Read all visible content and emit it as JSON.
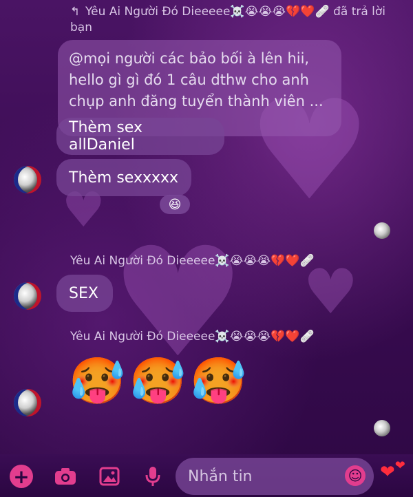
{
  "reply_header": {
    "text": "Yêu Ai Người Đó Dieeeee☠️😭😭😭💔❤️🩹 đã trả lời bạn"
  },
  "quoted_message": {
    "text": "@mọi người  các bảo bối à lên hii, hello gì gì đó 1 câu dthw cho anh chụp anh đăng tuyển thành viên ..."
  },
  "messages": [
    {
      "text": "Thèm sex allDaniel"
    },
    {
      "text": "Thèm sexxxxx"
    },
    {
      "text": "SEX"
    },
    {
      "text": "🥵🥵🥵"
    }
  ],
  "reaction": "😆",
  "sender_name": "Yêu Ai Người Đó Dieeeee☠️😭😭😭💔❤️🩹",
  "composer": {
    "placeholder": "Nhắn tin"
  },
  "icons": [
    "plus-icon",
    "camera-icon",
    "image-icon",
    "microphone-icon",
    "smile-icon",
    "hearts-icon",
    "reply-icon"
  ],
  "colors": {
    "accent": "#e23d8e",
    "bubble": "#7a4696",
    "background": "#3a0c52"
  }
}
